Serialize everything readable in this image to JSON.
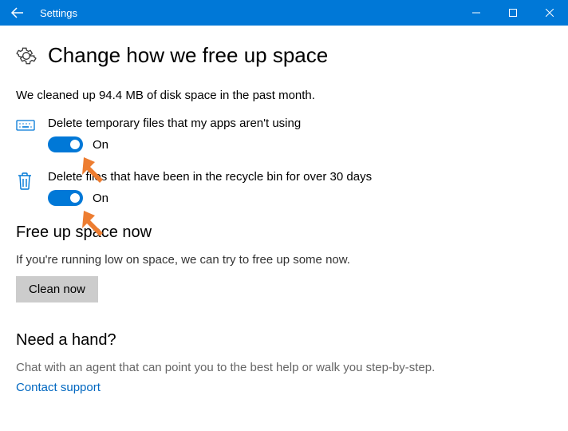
{
  "titlebar": {
    "title": "Settings"
  },
  "page": {
    "heading": "Change how we free up space",
    "status": "We cleaned up 94.4 MB of disk space in the past month."
  },
  "options": {
    "temp": {
      "label": "Delete temporary files that my apps aren't using",
      "state": "On"
    },
    "recycle": {
      "label": "Delete files that have been in the recycle bin for over 30 days",
      "state": "On"
    }
  },
  "freeup": {
    "title": "Free up space now",
    "text": "If you're running low on space, we can try to free up some now.",
    "button": "Clean now"
  },
  "help": {
    "title": "Need a hand?",
    "text": "Chat with an agent that can point you to the best help or walk you step-by-step.",
    "link": "Contact support"
  }
}
